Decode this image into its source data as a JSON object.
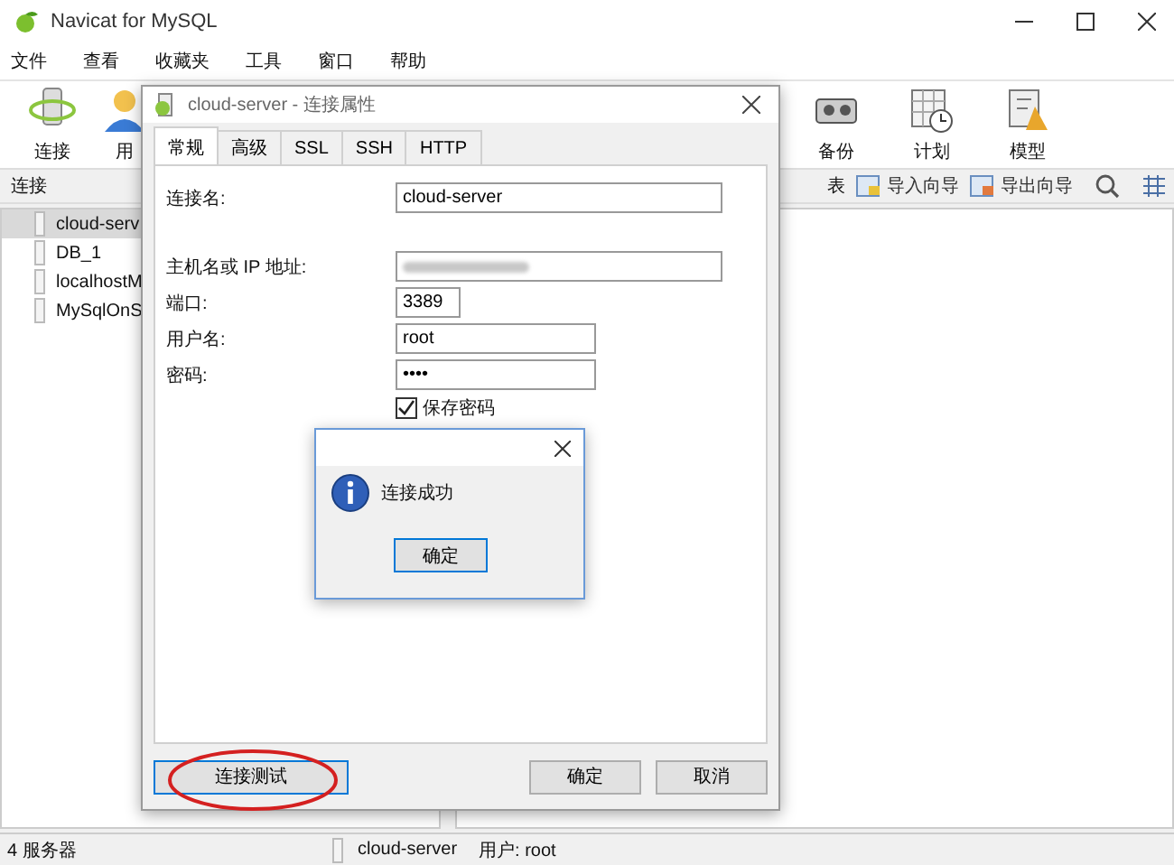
{
  "window": {
    "title": "Navicat for MySQL"
  },
  "menu": [
    "文件",
    "查看",
    "收藏夹",
    "工具",
    "窗口",
    "帮助"
  ],
  "toolbar": [
    {
      "label": "连接",
      "kind": "connect"
    },
    {
      "label": "用",
      "kind": "user"
    },
    {
      "label": "备份",
      "kind": "backup"
    },
    {
      "label": "计划",
      "kind": "schedule"
    },
    {
      "label": "模型",
      "kind": "model"
    }
  ],
  "subbar": {
    "label": "连接",
    "items": [
      {
        "label": "表",
        "kind": "table"
      },
      {
        "label": "导入向导",
        "kind": "import"
      },
      {
        "label": "导出向导",
        "kind": "export"
      }
    ]
  },
  "tree": [
    {
      "label": "cloud-serv",
      "selected": true
    },
    {
      "label": "DB_1",
      "selected": false
    },
    {
      "label": "localhostM",
      "selected": false
    },
    {
      "label": "MySqlOnS",
      "selected": false
    }
  ],
  "status_bar": {
    "count": "4 服务器",
    "connection": "cloud-server",
    "user": "用户: root"
  },
  "dialog": {
    "title": "cloud-server - 连接属性",
    "tabs": [
      {
        "label": "常规",
        "selected": true
      },
      {
        "label": "高级",
        "selected": false
      },
      {
        "label": "SSL",
        "selected": false
      },
      {
        "label": "SSH",
        "selected": false
      },
      {
        "label": "HTTP",
        "selected": false
      }
    ],
    "fields": [
      {
        "label": "连接名:",
        "value": "cloud-server",
        "redacted": false
      },
      {
        "label": "主机名或 IP 地址:",
        "redacted": true
      },
      {
        "label": "端口:",
        "value": "3389",
        "redacted": false
      },
      {
        "label": "用户名:",
        "value": "root",
        "redacted": false
      },
      {
        "label": "密码:",
        "value": "••••",
        "redacted": false
      }
    ],
    "save_password": {
      "label": "保存密码",
      "checked": true
    },
    "test_button": "连接测试",
    "ok_button": "确定",
    "cancel_button": "取消"
  },
  "message": {
    "text": "连接成功",
    "ok_button": "确定"
  }
}
